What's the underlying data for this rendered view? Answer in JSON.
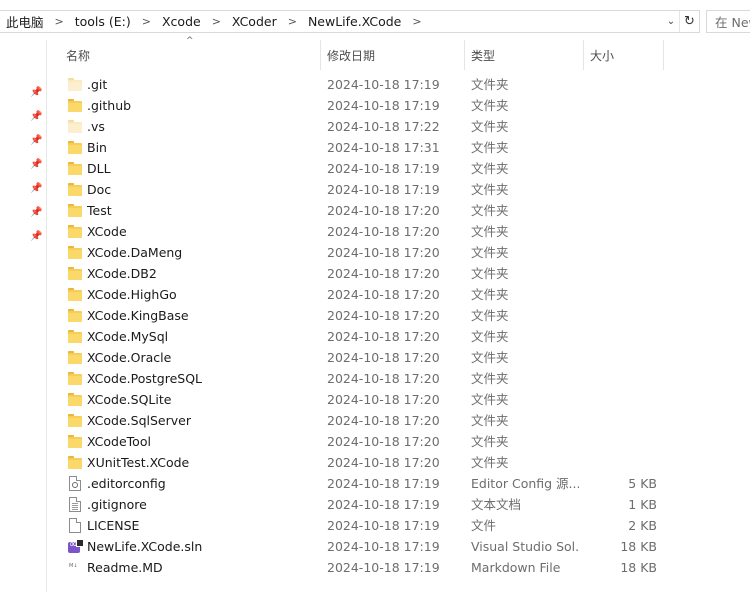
{
  "breadcrumb": [
    {
      "label": "此电脑"
    },
    {
      "label": "tools (E:)"
    },
    {
      "label": "Xcode"
    },
    {
      "label": "XCoder"
    },
    {
      "label": "NewLife.XCode"
    }
  ],
  "search": {
    "placeholder": "在 NewLife.XCode 中搜索"
  },
  "columns": {
    "name": "名称",
    "date": "修改日期",
    "type": "类型",
    "size": "大小"
  },
  "files": [
    {
      "name": ".git",
      "date": "2024-10-18 17:19",
      "type": "文件夹",
      "size": "",
      "icon": "folder-hidden-icon"
    },
    {
      "name": ".github",
      "date": "2024-10-18 17:19",
      "type": "文件夹",
      "size": "",
      "icon": "folder-icon"
    },
    {
      "name": ".vs",
      "date": "2024-10-18 17:22",
      "type": "文件夹",
      "size": "",
      "icon": "folder-hidden-icon"
    },
    {
      "name": "Bin",
      "date": "2024-10-18 17:31",
      "type": "文件夹",
      "size": "",
      "icon": "folder-icon"
    },
    {
      "name": "DLL",
      "date": "2024-10-18 17:19",
      "type": "文件夹",
      "size": "",
      "icon": "folder-icon"
    },
    {
      "name": "Doc",
      "date": "2024-10-18 17:19",
      "type": "文件夹",
      "size": "",
      "icon": "folder-icon"
    },
    {
      "name": "Test",
      "date": "2024-10-18 17:20",
      "type": "文件夹",
      "size": "",
      "icon": "folder-icon"
    },
    {
      "name": "XCode",
      "date": "2024-10-18 17:20",
      "type": "文件夹",
      "size": "",
      "icon": "folder-icon"
    },
    {
      "name": "XCode.DaMeng",
      "date": "2024-10-18 17:20",
      "type": "文件夹",
      "size": "",
      "icon": "folder-icon"
    },
    {
      "name": "XCode.DB2",
      "date": "2024-10-18 17:20",
      "type": "文件夹",
      "size": "",
      "icon": "folder-icon"
    },
    {
      "name": "XCode.HighGo",
      "date": "2024-10-18 17:20",
      "type": "文件夹",
      "size": "",
      "icon": "folder-icon"
    },
    {
      "name": "XCode.KingBase",
      "date": "2024-10-18 17:20",
      "type": "文件夹",
      "size": "",
      "icon": "folder-icon"
    },
    {
      "name": "XCode.MySql",
      "date": "2024-10-18 17:20",
      "type": "文件夹",
      "size": "",
      "icon": "folder-icon"
    },
    {
      "name": "XCode.Oracle",
      "date": "2024-10-18 17:20",
      "type": "文件夹",
      "size": "",
      "icon": "folder-icon"
    },
    {
      "name": "XCode.PostgreSQL",
      "date": "2024-10-18 17:20",
      "type": "文件夹",
      "size": "",
      "icon": "folder-icon"
    },
    {
      "name": "XCode.SQLite",
      "date": "2024-10-18 17:20",
      "type": "文件夹",
      "size": "",
      "icon": "folder-icon"
    },
    {
      "name": "XCode.SqlServer",
      "date": "2024-10-18 17:20",
      "type": "文件夹",
      "size": "",
      "icon": "folder-icon"
    },
    {
      "name": "XCodeTool",
      "date": "2024-10-18 17:20",
      "type": "文件夹",
      "size": "",
      "icon": "folder-icon"
    },
    {
      "name": "XUnitTest.XCode",
      "date": "2024-10-18 17:20",
      "type": "文件夹",
      "size": "",
      "icon": "folder-icon"
    },
    {
      "name": ".editorconfig",
      "date": "2024-10-18 17:19",
      "type": "Editor Config 源...",
      "size": "5 KB",
      "icon": "config-file-icon"
    },
    {
      "name": ".gitignore",
      "date": "2024-10-18 17:19",
      "type": "文本文档",
      "size": "1 KB",
      "icon": "text-file-icon"
    },
    {
      "name": "LICENSE",
      "date": "2024-10-18 17:19",
      "type": "文件",
      "size": "2 KB",
      "icon": "file-icon"
    },
    {
      "name": "NewLife.XCode.sln",
      "date": "2024-10-18 17:19",
      "type": "Visual Studio Sol...",
      "size": "18 KB",
      "icon": "visual-studio-solution-icon"
    },
    {
      "name": "Readme.MD",
      "date": "2024-10-18 17:19",
      "type": "Markdown File",
      "size": "18 KB",
      "icon": "markdown-file-icon"
    }
  ]
}
